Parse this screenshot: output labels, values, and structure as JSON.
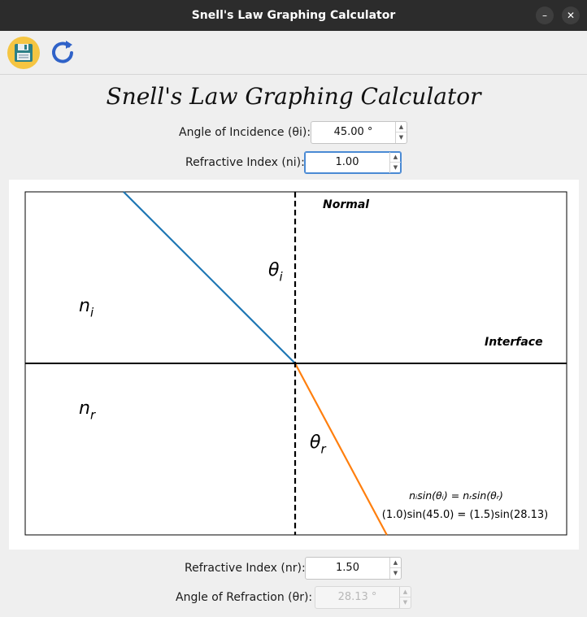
{
  "window": {
    "title": "Snell's Law Graphing Calculator",
    "minimize_glyph": "–",
    "close_glyph": "✕"
  },
  "toolbar": {
    "save_icon": "floppy-disk-save-icon",
    "reset_icon": "refresh-reset-icon"
  },
  "heading": "Snell's Law Graphing Calculator",
  "inputs": {
    "angle_incidence": {
      "label": "Angle of Incidence (θi):",
      "value": "45.00 °"
    },
    "refractive_index_i": {
      "label": "Refractive Index (ni):",
      "value": "1.00"
    },
    "refractive_index_r": {
      "label": "Refractive Index (nr):",
      "value": "1.50"
    },
    "angle_refraction": {
      "label": "Angle of Refraction (θr):",
      "value": "28.13 °",
      "disabled": true
    }
  },
  "spin_arrows": {
    "up": "▲",
    "down": "▼"
  },
  "chart_data": {
    "type": "line",
    "theta_i_deg": 45.0,
    "theta_r_deg": 28.13,
    "n_i": 1.0,
    "n_r": 1.5,
    "texts": {
      "normal": "Normal",
      "interface": "Interface",
      "n_i_label": "n",
      "n_i_sub": "i",
      "n_r_label": "n",
      "n_r_sub": "r",
      "theta_i_label": "θ",
      "theta_i_sub": "i",
      "theta_r_label": "θ",
      "theta_r_sub": "r",
      "equation_line1": "nᵢsin(θᵢ) = nᵣsin(θᵣ)",
      "equation_line2": "(1.0)sin(45.0) = (1.5)sin(28.13)"
    },
    "series": [
      {
        "values": [
          45.0
        ],
        "color": "#1f77b4"
      },
      {
        "values": [
          28.13
        ],
        "color": "#ff7f0e"
      }
    ],
    "colors": {
      "incident": "#1f77b4",
      "refracted": "#ff7f0e",
      "axes": "#000000"
    }
  }
}
